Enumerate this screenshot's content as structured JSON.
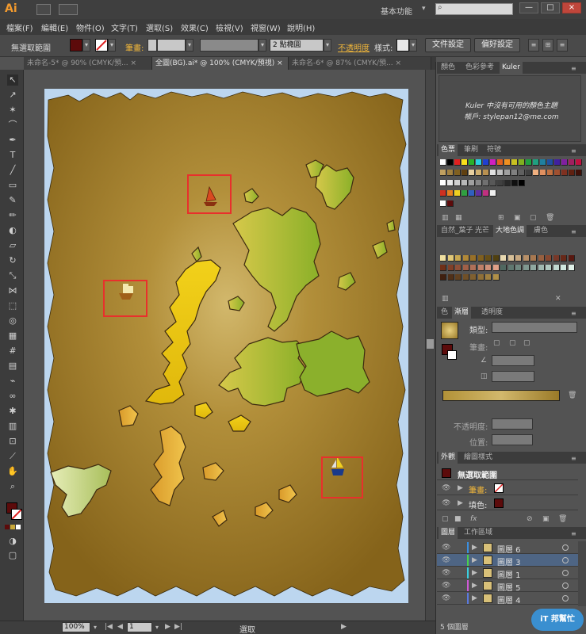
{
  "app": {
    "logo": "Ai",
    "workspace": "基本功能",
    "window_buttons": [
      "—",
      "□",
      "×"
    ]
  },
  "menu": [
    "檔案(F)",
    "編輯(E)",
    "物件(O)",
    "文字(T)",
    "選取(S)",
    "效果(C)",
    "檢視(V)",
    "視窗(W)",
    "說明(H)"
  ],
  "control": {
    "selection": "無選取範圍",
    "stroke_label": "筆畫:",
    "stroke_size": "2 點橢圓",
    "opacity_label": "不透明度",
    "style_label": "樣式:",
    "doc_setup": "文件設定",
    "preferences": "偏好設定",
    "fill_color": "#5c0b0b"
  },
  "tabs": [
    {
      "label": "未命名-5* @ 90% (CMYK/預...",
      "close": "×"
    },
    {
      "label": "全圖(BG).ai* @ 100% (CMYK/預視)",
      "close": "×"
    },
    {
      "label": "未命名-6* @ 87% (CMYK/預...",
      "close": "×"
    }
  ],
  "status": {
    "zoom": "100%",
    "page": "1",
    "text": "選取"
  },
  "panels": {
    "color_tabs": [
      "顏色",
      "色彩參考",
      "Kuler"
    ],
    "kuler_msg1": "Kuler 中沒有可用的顏色主題",
    "kuler_msg2": "帳戶: stylepan12@me.com",
    "swatch_tabs": [
      "色票",
      "筆刷",
      "符號"
    ],
    "lib_tabs": [
      "自然_葉子",
      "光芒",
      "大地色調",
      "膚色"
    ],
    "gradient_tabs": [
      "色",
      "漸層",
      "透明度"
    ],
    "gradient_type_label": "類型:",
    "gradient_stroke_label": "筆畫:",
    "gradient_opacity_label": "不透明度:",
    "gradient_position_label": "位置:",
    "appearance_tabs": [
      "外觀",
      "繪圖樣式"
    ],
    "appearance_title": "無選取範圍",
    "appearance_stroke": "筆畫:",
    "appearance_fill": "填色:",
    "layer_tabs": [
      "圖層",
      "工作區域"
    ],
    "layers": [
      {
        "name": "圖層 6",
        "color": "#3b8fe0"
      },
      {
        "name": "圖層 3",
        "color": "#4ad14a"
      },
      {
        "name": "圖層 1",
        "color": "#3ad0e0"
      },
      {
        "name": "圖層 5",
        "color": "#d05ad8"
      },
      {
        "name": "圖層 4",
        "color": "#5a7ae0"
      }
    ],
    "layer_count": "5 個圖層",
    "watermark": "iT 邦幫忙"
  }
}
